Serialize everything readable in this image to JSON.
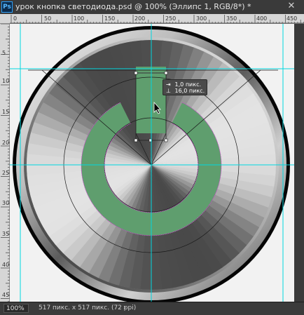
{
  "app": {
    "icon_text": "Ps",
    "title": "урок кнопка светодиода.psd @ 100% (Эллипс 1, RGB/8*) *",
    "close_glyph": "✕"
  },
  "rulers": {
    "horizontal_labels": [
      "0",
      "50",
      "100",
      "150",
      "200",
      "250",
      "300",
      "350",
      "400",
      "450"
    ],
    "vertical_labels": [
      "5",
      "100",
      "150",
      "200",
      "250",
      "300",
      "350",
      "400",
      "450"
    ]
  },
  "tooltip": {
    "row1_icon": "⇥",
    "row1_text": "1,0 пикс.",
    "row2_icon": "⊥",
    "row2_text": "16,0 пикс."
  },
  "status": {
    "zoom": "100%",
    "doc_size": "517 пикс. x 517 пикс. (72 ppi)",
    "arrow": "›"
  },
  "colors": {
    "guide": "#00d8e0",
    "green_fill": "#5f9e6e",
    "path_magenta": "#d040d0",
    "outer_rim": "#000000"
  },
  "icons": {
    "ps_logo": "ps-icon",
    "close": "close-icon",
    "cursor": "arrow-cursor-icon"
  }
}
